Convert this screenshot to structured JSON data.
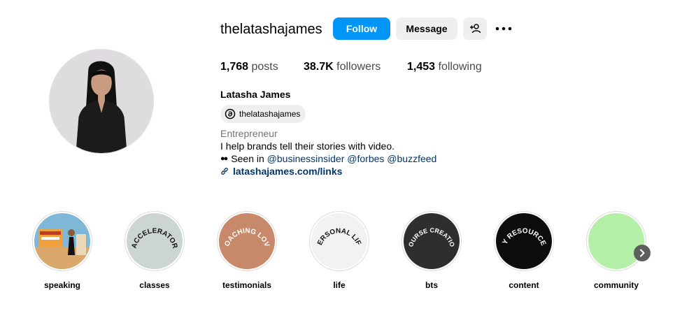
{
  "profile": {
    "username": "thelatashajames",
    "follow_label": "Follow",
    "message_label": "Message",
    "suggest_icon": "add-person-icon",
    "more_icon": "more-options-icon",
    "full_name": "Latasha James",
    "threads_handle": "thelatashajames",
    "category": "Entrepreneur",
    "bio_line1": "I help brands tell their stories with video.",
    "bio_seen_prefix": "Seen in",
    "bio_mentions": [
      "@businessinsider",
      "@forbes",
      "@buzzfeed"
    ],
    "link": "latashajames.com/links"
  },
  "stats": {
    "posts_count": "1,768",
    "posts_label": "posts",
    "followers_count": "38.7K",
    "followers_label": "followers",
    "following_count": "1,453",
    "following_label": "following"
  },
  "highlights": [
    {
      "label": "speaking",
      "cover_text": "",
      "color": "#7fb8d6"
    },
    {
      "label": "classes",
      "cover_text": "ACCELERATOR",
      "color": "#ccd5d3"
    },
    {
      "label": "testimonials",
      "cover_text": "COACHING LOVE",
      "color": "#c8896a"
    },
    {
      "label": "life",
      "cover_text": "PERSONAL LIFE",
      "color": "#f2f2f2"
    },
    {
      "label": "bts",
      "cover_text": "COURSE CREATION",
      "color": "#2e2e2e"
    },
    {
      "label": "content",
      "cover_text": "MY RESOURCES",
      "color": "#0d0d0d"
    },
    {
      "label": "community",
      "cover_text": "",
      "color": "#b4efa8"
    }
  ],
  "colors": {
    "follow_button": "#0095f6",
    "secondary_button": "#efefef",
    "link_text": "#00376b",
    "muted_text": "#737373"
  },
  "icons": {
    "threads": "threads-icon",
    "link": "link-chain-icon",
    "eyes": "eyes-emoji-icon",
    "next": "chevron-right-icon"
  }
}
